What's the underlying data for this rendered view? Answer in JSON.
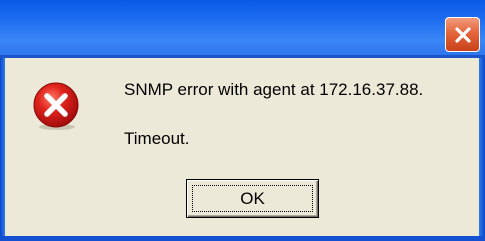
{
  "dialog": {
    "message": "SNMP error with agent at 172.16.37.88.",
    "detail": "Timeout.",
    "ok_label": "OK",
    "icon": "error-icon",
    "close_icon": "close-icon"
  },
  "colors": {
    "titlebar": "#2a72ec",
    "dialog_bg": "#ece9d8",
    "close_button": "#e4653c",
    "error_red": "#d8141a"
  }
}
